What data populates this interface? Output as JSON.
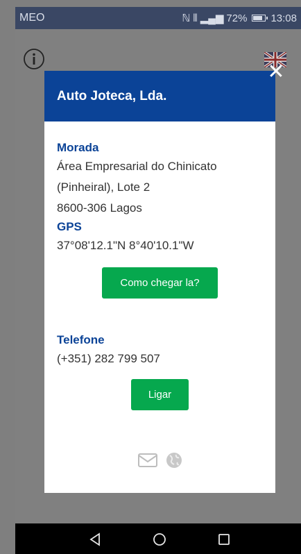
{
  "status": {
    "carrier": "MEO",
    "signal_text": "ℕ ⁴ᴳ",
    "battery": "72%",
    "time": "13:08"
  },
  "modal": {
    "title": "Auto Joteca, Lda.",
    "address_label": "Morada",
    "address_lines": [
      "Área Empresarial do Chinicato",
      "(Pinheiral), Lote 2",
      "8600-306 Lagos"
    ],
    "gps_label": "GPS",
    "gps_value": "37°08'12.1\"N 8°40'10.1\"W",
    "directions_button": "Como chegar la?",
    "phone_label": "Telefone",
    "phone_value": "(+351) 282 799 507",
    "call_button": "Ligar"
  },
  "icons": [
    "info-icon",
    "uk-flag-icon",
    "close-icon",
    "envelope-icon",
    "globe-icon",
    "back-icon",
    "home-icon",
    "recents-icon"
  ]
}
